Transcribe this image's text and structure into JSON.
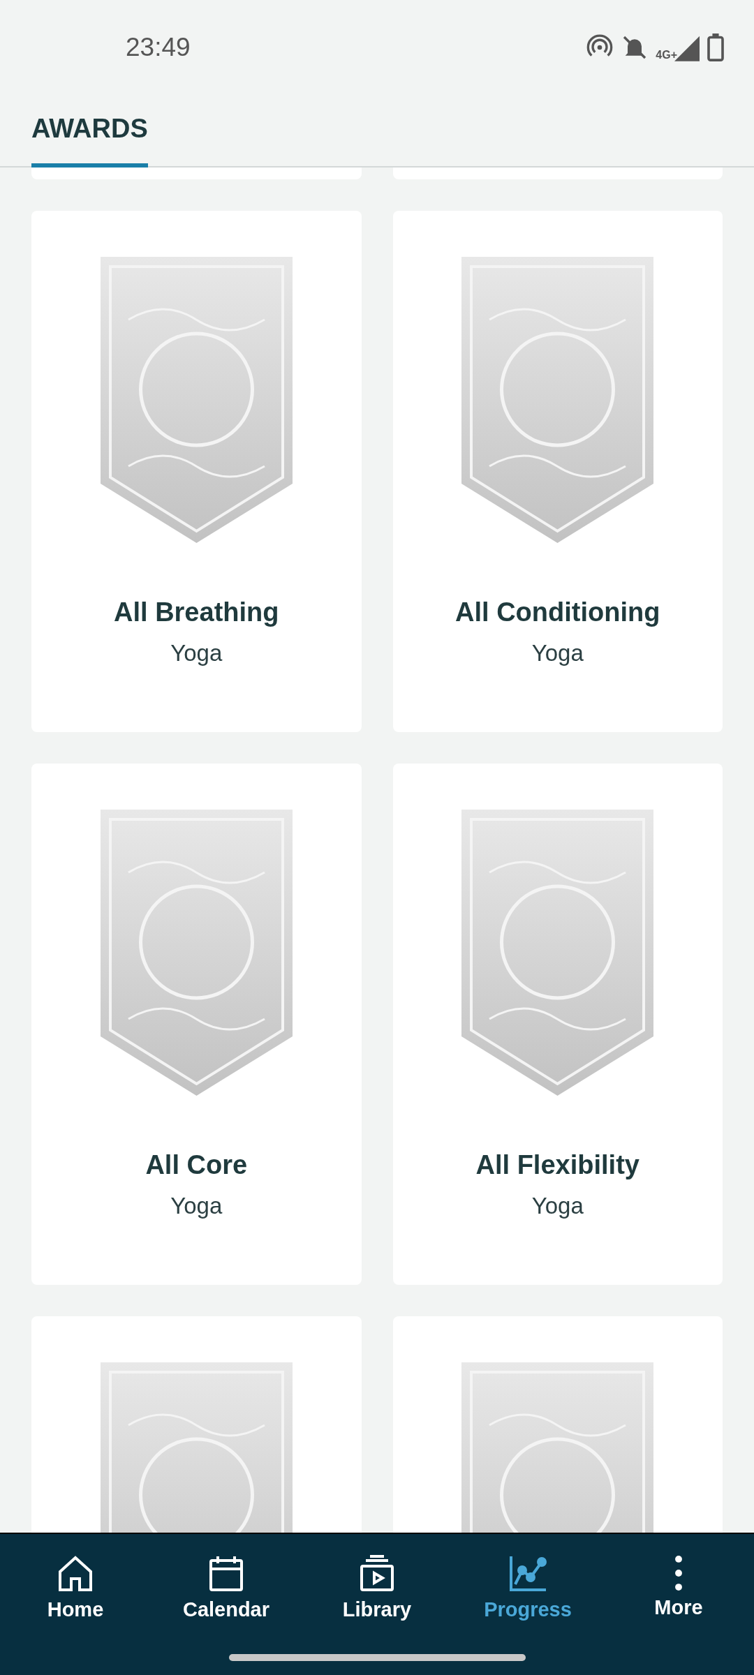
{
  "status_bar": {
    "time": "23:49",
    "network": "4G+"
  },
  "header": {
    "tabs": [
      {
        "label": "AWARDS",
        "selected": true
      }
    ]
  },
  "awards": [
    {
      "title": "All Breathing",
      "subtitle": "Yoga"
    },
    {
      "title": "All Conditioning",
      "subtitle": "Yoga"
    },
    {
      "title": "All Core",
      "subtitle": "Yoga"
    },
    {
      "title": "All Flexibility",
      "subtitle": "Yoga"
    }
  ],
  "bottom_nav": [
    {
      "label": "Home",
      "selected": false
    },
    {
      "label": "Calendar",
      "selected": false
    },
    {
      "label": "Library",
      "selected": false
    },
    {
      "label": "Progress",
      "selected": true
    },
    {
      "label": "More",
      "selected": false
    }
  ]
}
